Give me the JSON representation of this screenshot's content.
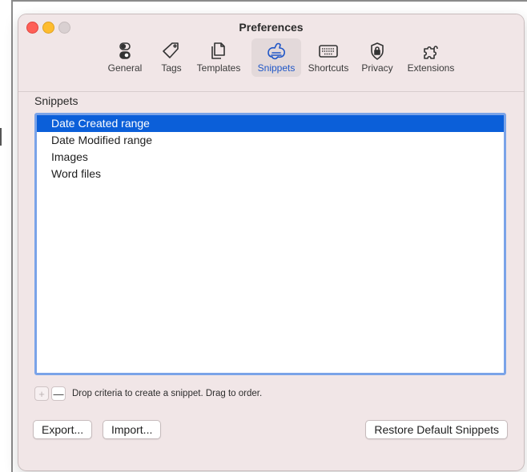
{
  "window": {
    "title": "Preferences"
  },
  "toolbar": {
    "tabs": [
      {
        "label": "General",
        "icon": "toggle-switches-icon"
      },
      {
        "label": "Tags",
        "icon": "tag-icon"
      },
      {
        "label": "Templates",
        "icon": "documents-icon"
      },
      {
        "label": "Snippets",
        "icon": "puzzle-rabbit-icon",
        "selected": true
      },
      {
        "label": "Shortcuts",
        "icon": "keyboard-icon"
      },
      {
        "label": "Privacy",
        "icon": "lock-shield-icon"
      },
      {
        "label": "Extensions",
        "icon": "puzzle-icon"
      }
    ]
  },
  "snippets": {
    "section_label": "Snippets",
    "items": [
      "Date Created range",
      "Date Modified range",
      "Images",
      "Word files"
    ],
    "selected_index": 0,
    "add_label": "+",
    "remove_label": "—",
    "hint": "Drop criteria to create a snippet. Drag to order."
  },
  "buttons": {
    "export": "Export...",
    "import": "Import...",
    "restore": "Restore Default Snippets"
  },
  "colors": {
    "window_bg": "#f1e6e7",
    "accent": "#1f56c7",
    "selection": "#0b5fd9",
    "list_focus_ring": "#7aa3e8"
  }
}
